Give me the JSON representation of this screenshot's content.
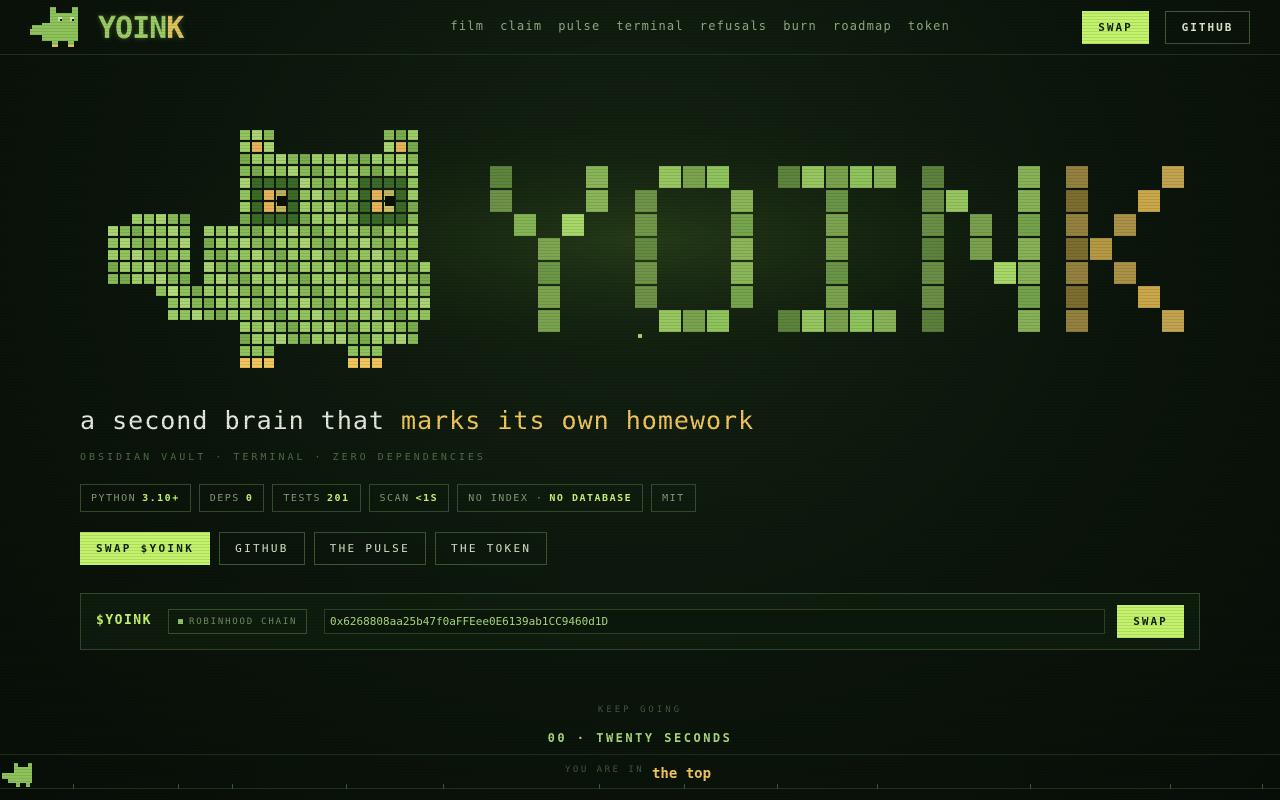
{
  "nav": {
    "brand": "YOIN",
    "brand_k": "K",
    "links": [
      "film",
      "claim",
      "pulse",
      "terminal",
      "refusals",
      "burn",
      "roadmap",
      "token"
    ],
    "swap_label": "SWAP",
    "github_label": "GITHUB"
  },
  "hero": {
    "logo_text": "YOINK",
    "tagline_plain": "a second brain that ",
    "tagline_highlight": "marks its own homework",
    "subline": "OBSIDIAN VAULT  ·  TERMINAL  ·  ZERO DEPENDENCIES"
  },
  "badges": [
    {
      "label": "PYTHON",
      "value": "3.10+"
    },
    {
      "label": "DEPS",
      "value": "0"
    },
    {
      "label": "TESTS",
      "value": "201"
    },
    {
      "label": "SCAN",
      "value": "<1S"
    },
    {
      "label": "NO INDEX ·",
      "value": "NO DATABASE"
    },
    {
      "label": "MIT",
      "value": ""
    }
  ],
  "cta": {
    "swap": "SWAP $YOINK",
    "github": "GITHUB",
    "pulse": "THE PULSE",
    "token": "THE TOKEN"
  },
  "token": {
    "label": "$YOINK",
    "chain": "ROBINHOOD CHAIN",
    "address": "0x6268808aa25b47f0aFFEee0E6139ab1CC9460d1D",
    "swap": "SWAP"
  },
  "footer": {
    "keep_going": "KEEP GOING",
    "timer": "00 · TWENTY SECONDS",
    "you_are_in": "YOU ARE IN",
    "place": "the top"
  },
  "colors": {
    "accent": "#c3f36b",
    "gold": "#f2c65a",
    "background": "#0b150b"
  },
  "icons": {
    "brand": "pixel-cat-icon",
    "hero": "pixel-cat-icon",
    "footer": "pixel-cat-icon"
  }
}
